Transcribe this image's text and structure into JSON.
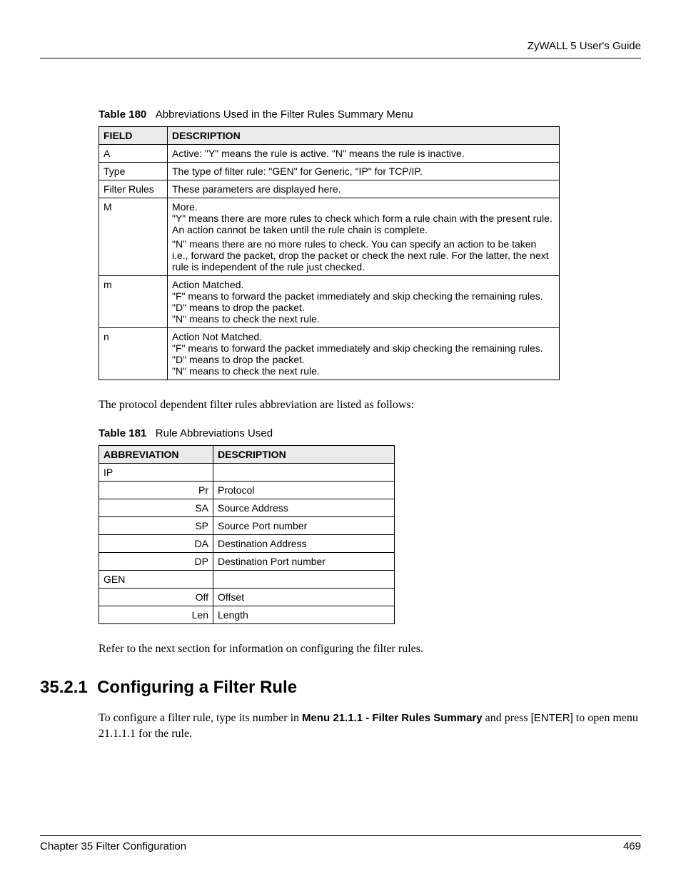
{
  "header": {
    "guide_title": "ZyWALL 5 User's Guide"
  },
  "table180": {
    "caption_num": "Table 180",
    "caption_text": "Abbreviations Used in the Filter Rules Summary Menu",
    "head_field": "FIELD",
    "head_desc": "DESCRIPTION",
    "rows": [
      {
        "field": "A",
        "desc": "Active: \"Y\" means the rule is active. \"N\" means the rule is inactive."
      },
      {
        "field": "Type",
        "desc": "The type of filter rule: \"GEN\" for Generic, \"IP\" for TCP/IP."
      },
      {
        "field": "Filter Rules",
        "desc": "These parameters are displayed here."
      },
      {
        "field": "M",
        "desc_p1": "More.",
        "desc_p2": "\"Y\" means there are more rules to check which form a rule chain with the present rule. An action cannot be taken until the rule chain is complete.",
        "desc_p3": "\"N\" means there are no more rules to check. You can specify an action to be taken i.e., forward the packet, drop the packet or check the next rule. For the latter, the next rule is independent of the rule just checked."
      },
      {
        "field": "m",
        "desc_p1": "Action Matched.",
        "desc_p2": "\"F\" means to forward the packet immediately and skip checking the remaining rules.",
        "desc_p3": "\"D\" means to drop the packet.",
        "desc_p4": "\"N\" means to check the next rule."
      },
      {
        "field": "n",
        "desc_p1": "Action Not Matched.",
        "desc_p2": "\"F\" means to forward the packet immediately and skip checking the remaining rules.",
        "desc_p3": "\"D\" means to drop the packet.",
        "desc_p4": "\"N\" means to check the next rule."
      }
    ]
  },
  "para1": "The protocol dependent filter rules abbreviation are listed as follows:",
  "table181": {
    "caption_num": "Table 181",
    "caption_text": "Rule Abbreviations Used",
    "head_abbr": "ABBREVIATION",
    "head_desc": "DESCRIPTION",
    "rows": [
      {
        "abbr": "IP",
        "desc": "",
        "left": true
      },
      {
        "abbr": "Pr",
        "desc": "Protocol"
      },
      {
        "abbr": "SA",
        "desc": "Source Address"
      },
      {
        "abbr": "SP",
        "desc": "Source Port number"
      },
      {
        "abbr": "DA",
        "desc": "Destination Address"
      },
      {
        "abbr": "DP",
        "desc": "Destination Port number"
      },
      {
        "abbr": "GEN",
        "desc": "",
        "left": true
      },
      {
        "abbr": "Off",
        "desc": "Offset"
      },
      {
        "abbr": "Len",
        "desc": "Length"
      }
    ]
  },
  "para2": "Refer to the next section for information on configuring the filter rules.",
  "section": {
    "number": "35.2.1",
    "title": "Configuring a Filter Rule",
    "body_pre": "To configure a filter rule, type its number in ",
    "body_menu": "Menu 21.1.1 - Filter Rules Summary",
    "body_mid": " and press ",
    "body_enter": "[ENTER]",
    "body_post": " to open menu 21.1.1.1 for the rule."
  },
  "footer": {
    "chapter": "Chapter 35 Filter Configuration",
    "page": "469"
  }
}
